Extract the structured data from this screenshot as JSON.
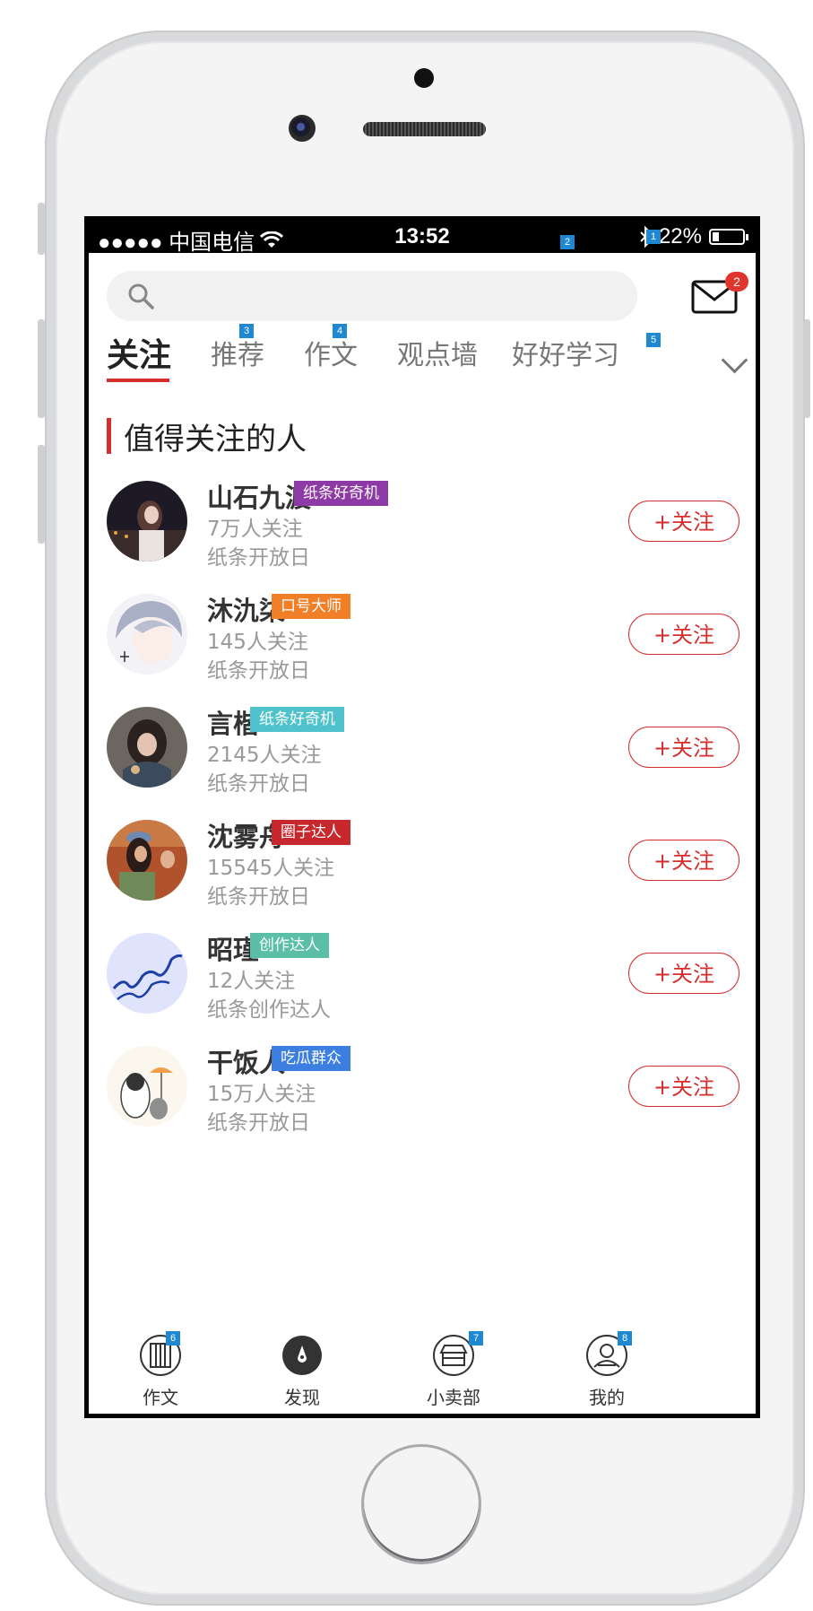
{
  "status_bar": {
    "signal": "●●●●● 中国电信",
    "time": "13:52",
    "battery": "22%",
    "battery_level": 0.22
  },
  "search": {
    "placeholder": "",
    "badge": "2"
  },
  "mail": {
    "unread": "2",
    "badge": "1"
  },
  "tabs": [
    {
      "label": "关注",
      "active": true,
      "badge": ""
    },
    {
      "label": "推荐",
      "badge": "3"
    },
    {
      "label": "作文",
      "badge": "4"
    },
    {
      "label": "观点墙",
      "badge": ""
    },
    {
      "label": "好好学习",
      "badge": ""
    }
  ],
  "tabs_more_badge": "5",
  "section_title": "值得关注的人",
  "people": [
    {
      "name": "山石九渡",
      "badge": "纸条好奇机",
      "badge_color": "#8e3aa6",
      "followers": "7万人关注",
      "note": "纸条开放日",
      "follow_label": "+关注"
    },
    {
      "name": "沐氿柒",
      "badge": "口号大师",
      "badge_color": "#f07f27",
      "followers": "145人关注",
      "note": "纸条开放日",
      "follow_label": "+关注"
    },
    {
      "name": "言楷",
      "badge": "纸条好奇机",
      "badge_color": "#4fc2cc",
      "followers": "2145人关注",
      "note": "纸条开放日",
      "follow_label": "+关注"
    },
    {
      "name": "沈雾舟",
      "badge": "圈子达人",
      "badge_color": "#c7282e",
      "followers": "15545人关注",
      "note": "纸条开放日",
      "follow_label": "+关注"
    },
    {
      "name": "昭瑾",
      "badge": "创作达人",
      "badge_color": "#5bbfa8",
      "followers": "12人关注",
      "note": "纸条创作达人",
      "follow_label": "+关注"
    },
    {
      "name": "干饭人",
      "badge": "吃瓜群众",
      "badge_color": "#3c7fe0",
      "followers": "15万人关注",
      "note": "纸条开放日",
      "follow_label": "+关注"
    }
  ],
  "bottom_nav": [
    {
      "label": "作文",
      "icon": "book-icon",
      "badge": "6"
    },
    {
      "label": "发现",
      "icon": "compass-icon",
      "badge": ""
    },
    {
      "label": "小卖部",
      "icon": "shop-icon",
      "badge": "7"
    },
    {
      "label": "我的",
      "icon": "profile-icon",
      "badge": "8"
    }
  ],
  "colors": {
    "accent": "#d42e2e",
    "tag_blue": "#1e88d2"
  }
}
